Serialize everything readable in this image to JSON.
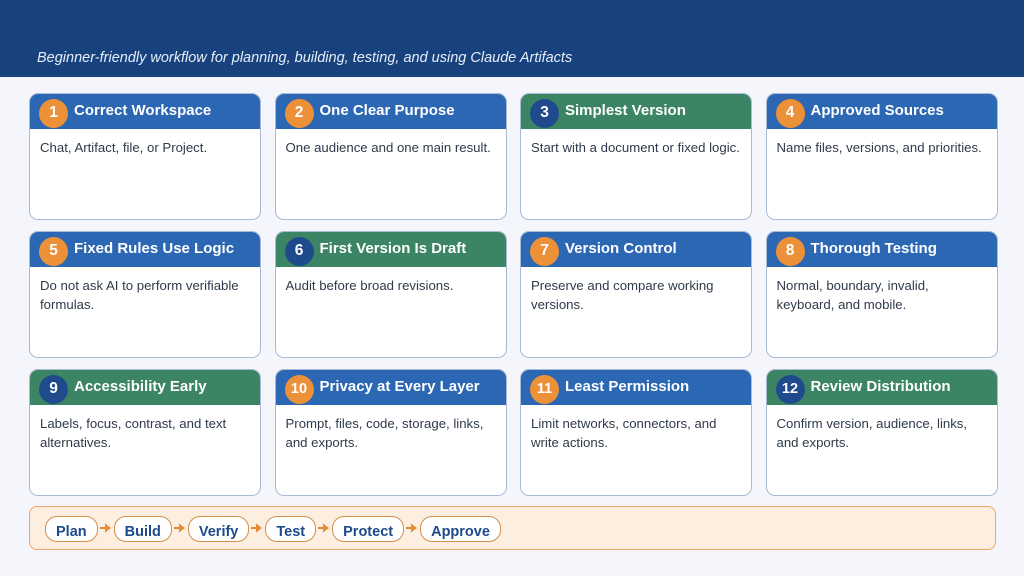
{
  "header": {
    "subtitle": "Beginner-friendly workflow for planning, building, testing, and using Claude Artifacts"
  },
  "colors": {
    "banner": "#17427e",
    "blue_header": "#2c67b3",
    "green_header": "#3b8565",
    "orange_badge": "#ec9138",
    "navy_badge": "#1f4b8c",
    "flow_background": "#fcefdf",
    "flow_border": "#eea865"
  },
  "cards": [
    {
      "number": "1",
      "title": "Correct Workspace",
      "body": "Chat, Artifact, file, or Project.",
      "header_color": "blue",
      "badge_color": "orange"
    },
    {
      "number": "2",
      "title": "One Clear Purpose",
      "body": "One audience and one main result.",
      "header_color": "blue",
      "badge_color": "orange"
    },
    {
      "number": "3",
      "title": "Simplest Version",
      "body": "Start with a document or fixed logic.",
      "header_color": "green",
      "badge_color": "navy"
    },
    {
      "number": "4",
      "title": "Approved Sources",
      "body": "Name files, versions, and priorities.",
      "header_color": "blue",
      "badge_color": "orange"
    },
    {
      "number": "5",
      "title": "Fixed Rules Use Logic",
      "body": "Do not ask AI to perform verifiable formulas.",
      "header_color": "blue",
      "badge_color": "orange"
    },
    {
      "number": "6",
      "title": "First Version Is Draft",
      "body": "Audit before broad revisions.",
      "header_color": "green",
      "badge_color": "navy"
    },
    {
      "number": "7",
      "title": "Version Control",
      "body": "Preserve and compare working versions.",
      "header_color": "blue",
      "badge_color": "orange"
    },
    {
      "number": "8",
      "title": "Thorough Testing",
      "body": "Normal, boundary, invalid, keyboard, and mobile.",
      "header_color": "blue",
      "badge_color": "orange"
    },
    {
      "number": "9",
      "title": "Accessibility Early",
      "body": "Labels, focus, contrast, and text alternatives.",
      "header_color": "green",
      "badge_color": "navy"
    },
    {
      "number": "10",
      "title": "Privacy at Every Layer",
      "body": "Prompt, files, code, storage, links, and exports.",
      "header_color": "blue",
      "badge_color": "orange"
    },
    {
      "number": "11",
      "title": "Least Permission",
      "body": "Limit networks, connectors, and write actions.",
      "header_color": "blue",
      "badge_color": "orange"
    },
    {
      "number": "12",
      "title": "Review Distribution",
      "body": "Confirm version, audience, links, and exports.",
      "header_color": "green",
      "badge_color": "navy"
    }
  ],
  "flow": {
    "steps": [
      "Plan",
      "Build",
      "Verify",
      "Test",
      "Protect",
      "Approve"
    ],
    "arrow_icon": "arrow-right-icon"
  }
}
